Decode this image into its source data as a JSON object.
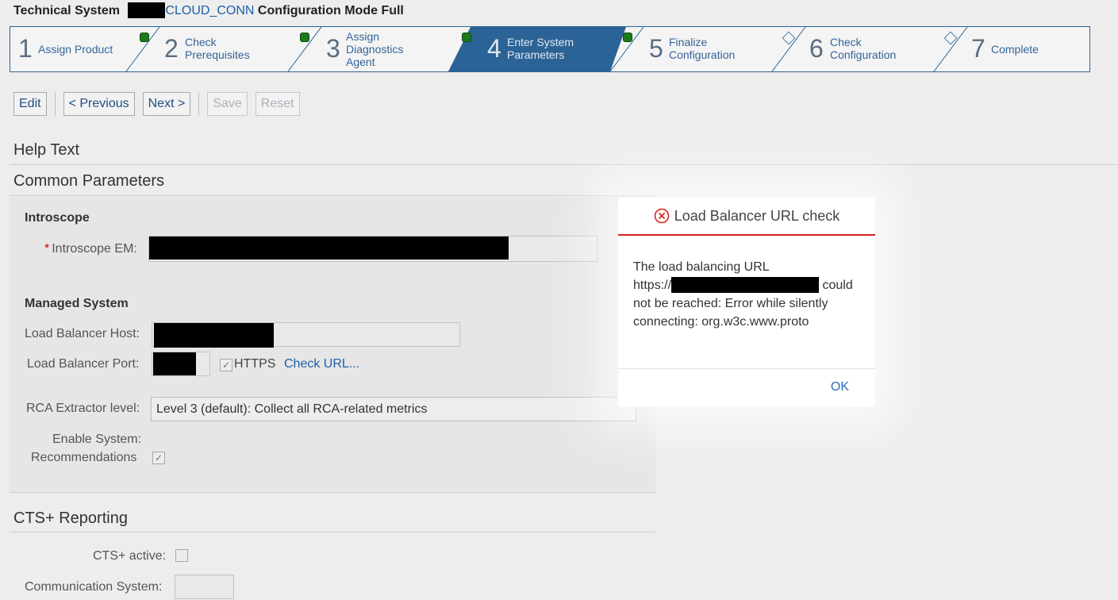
{
  "header": {
    "prefix": "Technical System",
    "system_link": "CLOUD_CONN",
    "suffix": "Configuration Mode Full"
  },
  "wizard": {
    "steps": [
      {
        "number": "1",
        "label": "Assign Product",
        "status": "complete"
      },
      {
        "number": "2",
        "label": "Check Prerequisites",
        "status": "complete"
      },
      {
        "number": "3",
        "label": "Assign Diagnostics Agent",
        "status": "complete"
      },
      {
        "number": "4",
        "label": "Enter System Parameters",
        "status": "complete",
        "active": true
      },
      {
        "number": "5",
        "label": "Finalize Configuration",
        "status": "pending"
      },
      {
        "number": "6",
        "label": "Check Configuration",
        "status": "pending"
      },
      {
        "number": "7",
        "label": "Complete",
        "status": "none"
      }
    ]
  },
  "toolbar": {
    "edit": "Edit",
    "previous": "< Previous",
    "next": "Next >",
    "save": "Save",
    "reset": "Reset"
  },
  "sections": {
    "help_text": "Help Text",
    "common_parameters": "Common Parameters",
    "cts_reporting": "CTS+ Reporting"
  },
  "introscope": {
    "title": "Introscope",
    "em_label": "Introscope EM:"
  },
  "managed_system": {
    "title": "Managed System",
    "host_label": "Load Balancer Host:",
    "port_label": "Load Balancer Port:",
    "https_label": "HTTPS",
    "https_checked": true,
    "check_url": "Check URL...",
    "rca_label": "RCA Extractor level:",
    "rca_value": "Level 3 (default): Collect all RCA-related metrics",
    "recommend_label_1": "Enable System:",
    "recommend_label_2": "Recommendations",
    "recommend_checked": true
  },
  "cts": {
    "active_label": "CTS+ active:",
    "active_checked": false,
    "comm_label": "Communication System:"
  },
  "dialog": {
    "title": "Load Balancer URL check",
    "line1": "The load balancing URL",
    "url_prefix": "https://",
    "line2_suffix": "could",
    "line3": "not be reached: Error while silently",
    "line4": "connecting: org.w3c.www.proto",
    "ok": "OK"
  },
  "colors": {
    "accent": "#2c6396",
    "active_step": "#2c6396",
    "error": "#d81e1e",
    "link": "#1f5fa8",
    "status_ok": "#1c7a1c"
  }
}
